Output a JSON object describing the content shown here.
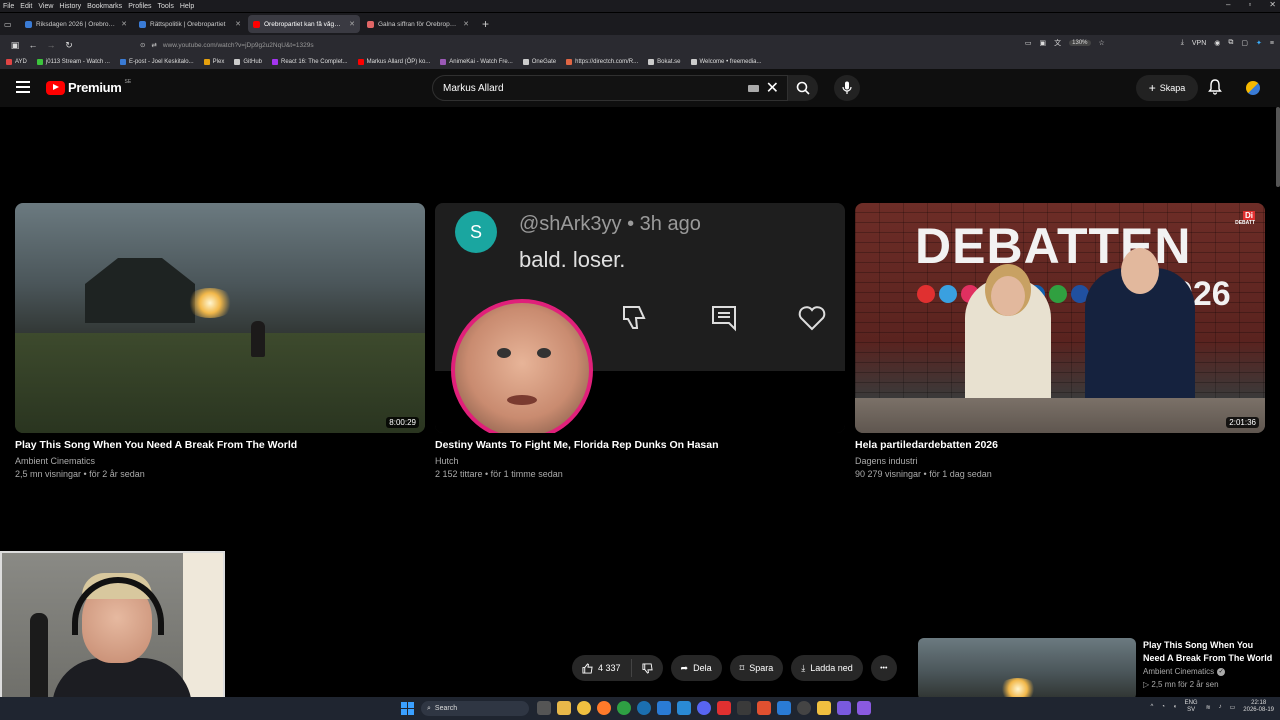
{
  "browser": {
    "menu": [
      "File",
      "Edit",
      "View",
      "History",
      "Bookmarks",
      "Profiles",
      "Tools",
      "Help"
    ],
    "window_controls": [
      "–",
      "▫",
      "✕"
    ],
    "tabs": [
      {
        "label": "Riksdagen 2026 | Örebropartiet",
        "color": "#3a7bd5",
        "active": false
      },
      {
        "label": "Rättspolitik | Örebropartiet",
        "color": "#3a7bd5",
        "active": false
      },
      {
        "label": "Örebropartiet kan få vågmästa",
        "color": "#ff0000",
        "active": true
      },
      {
        "label": "Galna siffran för Örebropartiet",
        "color": "#e06666",
        "active": false
      }
    ],
    "new_tab": "+",
    "url": "www.youtube.com/watch?v=jDp9g2u2NqU&t=1329s",
    "zoom": "130%",
    "vpn": "VPN",
    "bookmarks": [
      {
        "label": "AYD",
        "color": "#e04444"
      },
      {
        "label": "j0113 Stream - Watch ...",
        "color": "#3cc43c"
      },
      {
        "label": "E-post - Joel Keskitalo...",
        "color": "#3a7bd5"
      },
      {
        "label": "Plex",
        "color": "#e5a00d"
      },
      {
        "label": "GitHub",
        "color": "#cccccc"
      },
      {
        "label": "React 16: The Complet...",
        "color": "#a435f0"
      },
      {
        "label": "Markus Allard (ÖP) ko...",
        "color": "#ff0000"
      },
      {
        "label": "AnimeKai - Watch Fre...",
        "color": "#9b59b6"
      },
      {
        "label": "OneGate",
        "color": "#cccccc"
      },
      {
        "label": "https://directch.com/R...",
        "color": "#e06644"
      },
      {
        "label": "Bokat.se",
        "color": "#cccccc"
      },
      {
        "label": "Welcome • freemedia...",
        "color": "#cccccc"
      }
    ]
  },
  "youtube": {
    "logo_text": "Premium",
    "region": "SE",
    "search_value": "Markus Allard",
    "create_label": "Skapa",
    "videos": [
      {
        "title": "Play This Song When You Need A Break From The World",
        "channel": "Ambient Cinematics",
        "meta": "2,5 mn visningar • för 2 år sedan",
        "duration": "8:00:29"
      },
      {
        "title": "Destiny Wants To Fight Me, Florida Rep Dunks On Hasan",
        "channel": "Hutch",
        "meta": "2 152 tittare • för 1 timme sedan",
        "duration": ""
      },
      {
        "title": "Hela partiledardebatten 2026",
        "channel": "Dagens industri",
        "meta": "90 279 visningar • för 1 dag sedan",
        "duration": "2:01:36"
      }
    ],
    "comment_thumb": {
      "avatar_letter": "S",
      "user": "@shArk3yy • 3h ago",
      "text": "bald. loser."
    },
    "debate_thumb": {
      "headline": "DEBATTEN",
      "year": "2026",
      "brand": "Di",
      "brand_sub": "DEBATT"
    },
    "actions": {
      "likes": "4 337",
      "share": "Dela",
      "save": "Spara",
      "download": "Ladda ned",
      "more": "•••"
    },
    "up_next": {
      "title": "Play This Song When You Need A Break From The World",
      "channel": "Ambient Cinematics",
      "meta": "▷ 2,5 mn  för 2 år sen"
    }
  },
  "taskbar": {
    "search_placeholder": "Search",
    "language_top": "ENG",
    "language_bottom": "SV",
    "time": "22:18",
    "date": "2026-08-19"
  }
}
